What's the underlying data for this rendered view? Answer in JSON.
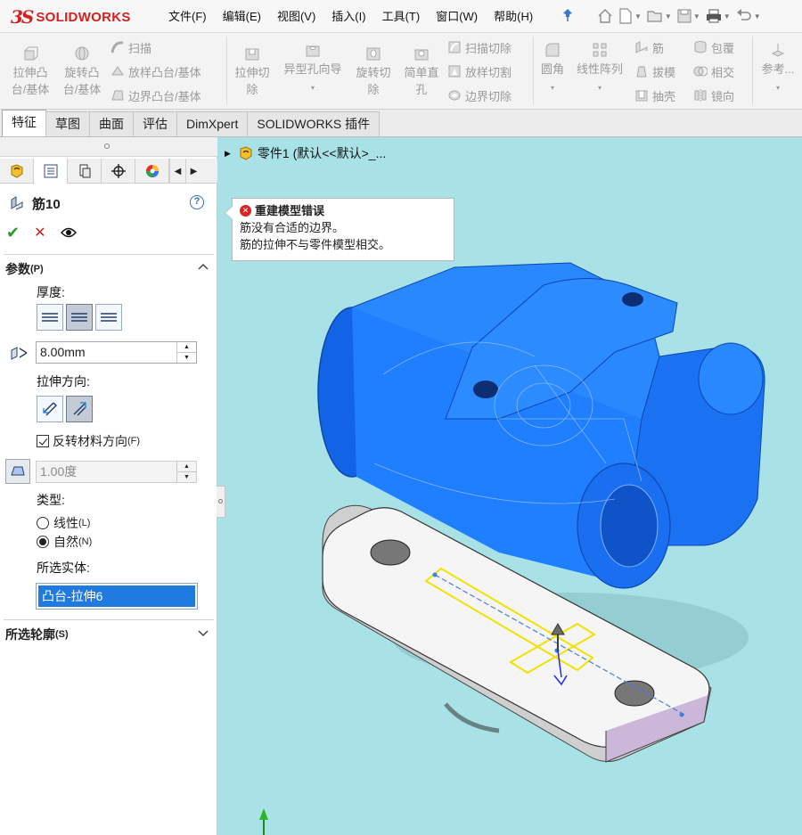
{
  "app": {
    "logo_text": "SOLIDWORKS",
    "logo_mark": "3S"
  },
  "menu": [
    "文件(F)",
    "编辑(E)",
    "视图(V)",
    "插入(I)",
    "工具(T)",
    "窗口(W)",
    "帮助(H)"
  ],
  "quick_access": [
    "home-icon",
    "new-icon",
    "open-icon",
    "save-icon",
    "print-icon",
    "undo-icon"
  ],
  "commands": {
    "extrude_boss": "拉伸凸台/基体",
    "revolve_boss": "旋转凸台/基体",
    "sweep": "扫描",
    "loft": "放样凸台/基体",
    "boundary_boss": "边界凸台/基体",
    "extrude_cut": "拉伸切除",
    "hole_wizard": "异型孔向导",
    "revolve_cut": "旋转切除",
    "simple_hole": "简单直孔",
    "swept_cut": "扫描切除",
    "lofted_cut": "放样切割",
    "boundary_cut": "边界切除",
    "fillet": "圆角",
    "linear_pattern": "线性阵列",
    "rib": "筋",
    "draft": "拔模",
    "shell": "抽壳",
    "wrap": "包覆",
    "intersect": "相交",
    "mirror": "镜向",
    "reference": "参考..."
  },
  "tabs": [
    "特征",
    "草图",
    "曲面",
    "评估",
    "DimXpert",
    "SOLIDWORKS 插件"
  ],
  "property_manager": {
    "feature_name": "筋10",
    "help": "?",
    "params_header": "参数",
    "params_header_key": "(P)",
    "thickness_label": "厚度:",
    "thickness_value": "8.00mm",
    "direction_label": "拉伸方向:",
    "flip_material": "反转材料方向",
    "flip_material_key": "(F)",
    "flip_material_checked": true,
    "draft_angle": "1.00度",
    "type_label": "类型:",
    "type_linear": "线性",
    "type_linear_key": "(L)",
    "type_natural": "自然",
    "type_natural_key": "(N)",
    "type_selected": "natural",
    "selected_bodies_label": "所选实体:",
    "selected_body": "凸台-拉伸6",
    "contours_header": "所选轮廓",
    "contours_header_key": "(S)"
  },
  "viewport": {
    "tree_item": "零件1  (默认<<默认>_...",
    "error_title": "重建模型错误",
    "error_line1": "筋没有合适的边界。",
    "error_line2": "筋的拉伸不与零件模型相交。",
    "background_color": "#a9e2e6",
    "body_color": "#1f7fff",
    "sketch_color": "#f1e200"
  }
}
